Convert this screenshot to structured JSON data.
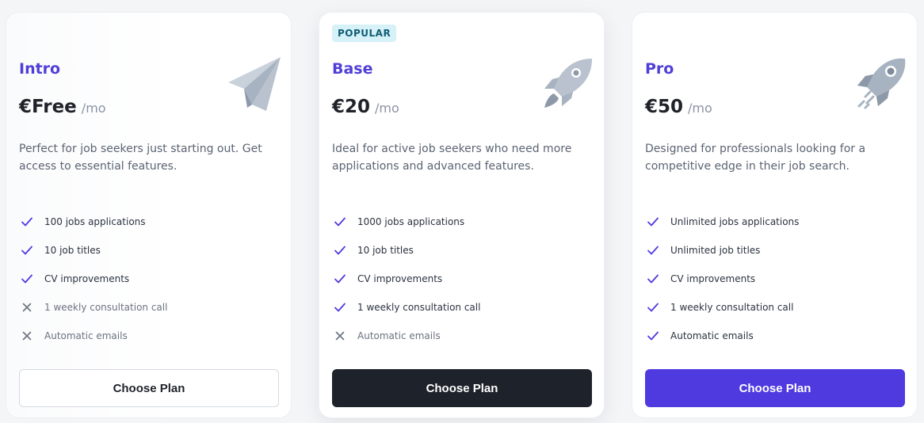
{
  "plans": [
    {
      "name": "Intro",
      "price": "€Free",
      "period": "/mo",
      "description": "Perfect for job seekers just starting out. Get access to essential features.",
      "features": [
        {
          "label": "100 jobs applications",
          "included": true
        },
        {
          "label": "10 job titles",
          "included": true
        },
        {
          "label": "CV improvements",
          "included": true
        },
        {
          "label": "1 weekly consultation call",
          "included": false
        },
        {
          "label": "Automatic emails",
          "included": false
        }
      ],
      "button": "Choose Plan",
      "icon": "paper-plane-icon"
    },
    {
      "badge": "POPULAR",
      "name": "Base",
      "price": "€20",
      "period": "/mo",
      "description": "Ideal for active job seekers who need more applications and advanced features.",
      "features": [
        {
          "label": "1000 jobs applications",
          "included": true
        },
        {
          "label": "10 job titles",
          "included": true
        },
        {
          "label": "CV improvements",
          "included": true
        },
        {
          "label": "1 weekly consultation call",
          "included": true
        },
        {
          "label": "Automatic emails",
          "included": false
        }
      ],
      "button": "Choose Plan",
      "icon": "rocket-icon"
    },
    {
      "name": "Pro",
      "price": "€50",
      "period": "/mo",
      "description": "Designed for professionals looking for a competitive edge in their job search.",
      "features": [
        {
          "label": "Unlimited jobs applications",
          "included": true
        },
        {
          "label": "Unlimited job titles",
          "included": true
        },
        {
          "label": "CV improvements",
          "included": true
        },
        {
          "label": "1 weekly consultation call",
          "included": true
        },
        {
          "label": "Automatic emails",
          "included": true
        }
      ],
      "button": "Choose Plan",
      "icon": "rocket-launch-icon"
    }
  ],
  "colors": {
    "accent": "#4f3fd6",
    "check": "#4f3ae0",
    "cross": "#6b7280",
    "dark_button": "#1e232b",
    "purple_button": "#4f3ae0",
    "badge_bg": "#d6f1f7"
  }
}
